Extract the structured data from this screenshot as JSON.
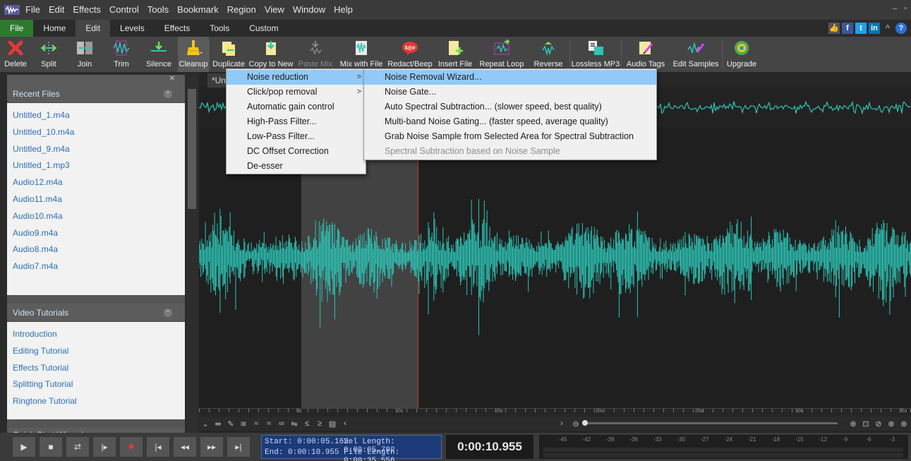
{
  "menubar": {
    "items": [
      "File",
      "Edit",
      "Effects",
      "Control",
      "Tools",
      "Bookmark",
      "Region",
      "View",
      "Window",
      "Help"
    ]
  },
  "ribbon": {
    "tabs": [
      "File",
      "Home",
      "Edit",
      "Levels",
      "Effects",
      "Tools",
      "Custom"
    ],
    "active_tab": "Edit"
  },
  "toolbar": {
    "buttons": [
      {
        "label": "Delete",
        "icon": "delete-icon"
      },
      {
        "label": "Split",
        "icon": "split-icon"
      },
      {
        "label": "Join",
        "icon": "join-icon"
      },
      {
        "label": "Trim",
        "icon": "trim-icon"
      },
      {
        "label": "Silence",
        "icon": "silence-icon"
      },
      {
        "label": "Cleanup",
        "icon": "cleanup-icon"
      },
      {
        "label": "Duplicate",
        "icon": "duplicate-icon"
      },
      {
        "label": "Copy to New",
        "icon": "copy-to-new-icon"
      },
      {
        "label": "Paste Mix",
        "icon": "paste-mix-icon"
      },
      {
        "label": "Mix with File",
        "icon": "mix-with-file-icon"
      },
      {
        "label": "Redact/Beep",
        "icon": "redact-beep-icon"
      },
      {
        "label": "Insert File",
        "icon": "insert-file-icon"
      },
      {
        "label": "Repeat Loop",
        "icon": "repeat-loop-icon"
      },
      {
        "label": "Reverse",
        "icon": "reverse-icon"
      },
      {
        "label": "Lossless MP3",
        "icon": "lossless-mp3-icon"
      },
      {
        "label": "Audio Tags",
        "icon": "audio-tags-icon"
      },
      {
        "label": "Edit Samples",
        "icon": "edit-samples-icon"
      },
      {
        "label": "Upgrade",
        "icon": "upgrade-icon"
      }
    ]
  },
  "sidebar": {
    "recent": {
      "title": "Recent Files",
      "items": [
        "Untitled_1.m4a",
        "Untitled_10.m4a",
        "Untitled_9.m4a",
        "Untitled_1.mp3",
        "Audio12.m4a",
        "Audio11.m4a",
        "Audio10.m4a",
        "Audio9.m4a",
        "Audio8.m4a",
        "Audio7.m4a"
      ]
    },
    "tutorials": {
      "title": "Video Tutorials",
      "items": [
        "Introduction",
        "Editing Tutorial",
        "Effects Tutorial",
        "Splitting Tutorial",
        "Ringtone Tutorial"
      ]
    },
    "quickstart": {
      "title": "Quick Start Wizards"
    }
  },
  "editor": {
    "file_tab": "*Unt"
  },
  "cleanup_menu": {
    "items": [
      {
        "label": "Noise reduction",
        "submenu": ">"
      },
      {
        "label": "Click/pop removal",
        "submenu": ">"
      },
      {
        "label": "Automatic gain control"
      },
      {
        "label": "High-Pass Filter..."
      },
      {
        "label": "Low-Pass Filter..."
      },
      {
        "label": "DC Offset Correction"
      },
      {
        "label": "De-esser"
      }
    ]
  },
  "noise_menu": {
    "items": [
      {
        "label": "Noise Removal Wizard..."
      },
      {
        "label": "Noise Gate..."
      },
      {
        "label": "Auto Spectral Subtraction... (slower speed, best quality)"
      },
      {
        "label": "Multi-band Noise Gating... (faster speed, average quality)"
      },
      {
        "label": "Grab Noise Sample from Selected Area for Spectral Subtraction"
      },
      {
        "label": "Spectral Subtraction based on Noise Sample",
        "disabled": true
      }
    ]
  },
  "status": {
    "start": "Start:  0:00:05.162",
    "end": "End:  0:00:10.955",
    "sel_length": "Sel Length:  0:00:05.792",
    "file_length": "File Length:  0:00:35.556",
    "position": "0:00:10.955"
  },
  "ruler": {
    "labels": [
      "5s",
      "10s",
      "15s",
      "20s",
      "25s",
      "30s",
      "35s"
    ]
  },
  "meter": {
    "labels": [
      "-45",
      "-42",
      "-39",
      "-36",
      "-33",
      "-30",
      "-27",
      "-24",
      "-21",
      "-18",
      "-15",
      "-12",
      "-9",
      "-6",
      "-3"
    ]
  },
  "colors": {
    "waveform": "#2ec4b6",
    "selection": "#424242",
    "cursor": "#d0312d",
    "menu_highlight": "#91c9f7",
    "file_tab": "#2d7a2f",
    "link": "#2e6fb6"
  }
}
